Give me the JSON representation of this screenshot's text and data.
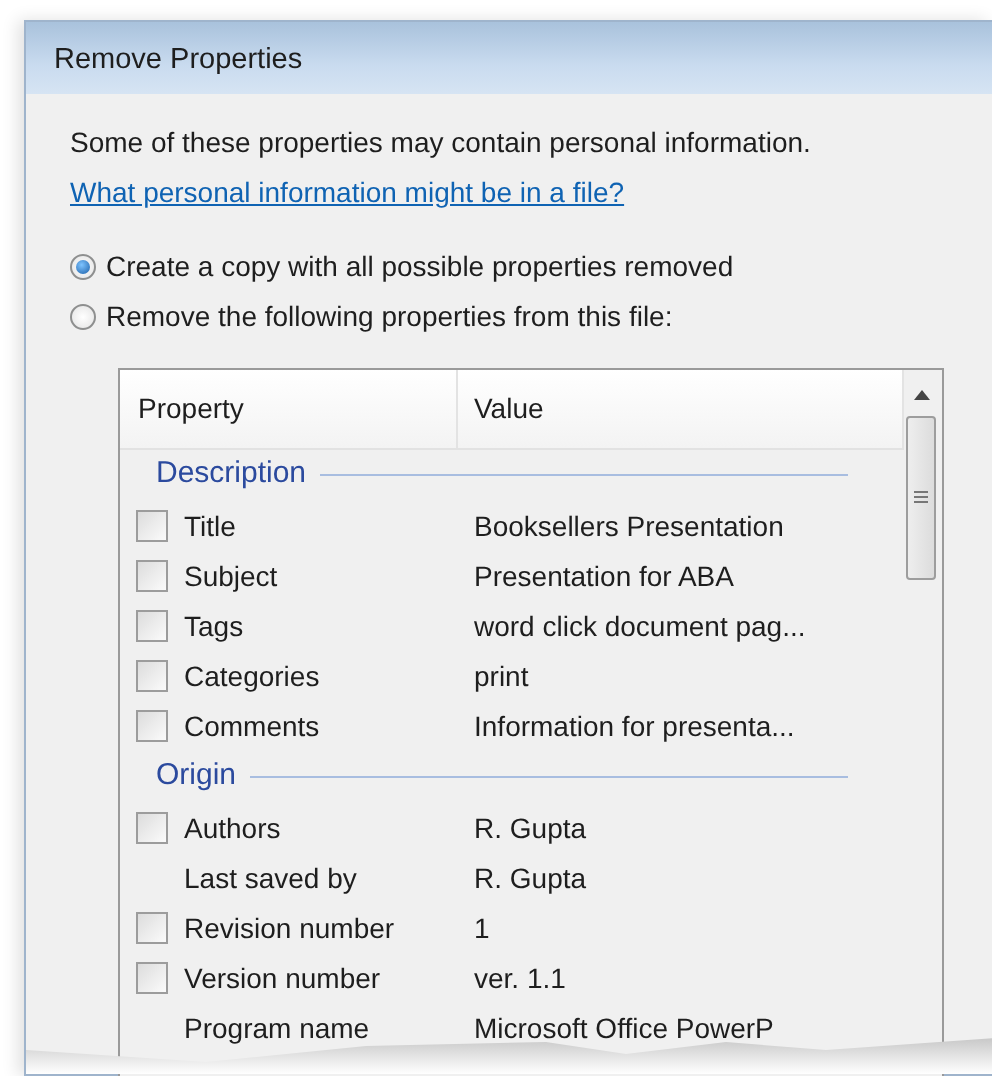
{
  "window": {
    "title": "Remove Properties"
  },
  "intro": "Some of these properties may contain personal information.",
  "help_link": "What personal information might be in a file?",
  "options": [
    {
      "label": "Create a copy with all possible properties removed",
      "selected": true
    },
    {
      "label": "Remove the following properties from this file:",
      "selected": false
    }
  ],
  "table": {
    "columns": [
      "Property",
      "Value"
    ],
    "groups": [
      {
        "name": "Description",
        "rows": [
          {
            "kind": "check",
            "checked": false,
            "property": "Title",
            "value": "Booksellers Presentation"
          },
          {
            "kind": "check",
            "checked": false,
            "property": "Subject",
            "value": "Presentation for ABA"
          },
          {
            "kind": "check",
            "checked": false,
            "property": "Tags",
            "value": "word click document pag..."
          },
          {
            "kind": "check",
            "checked": false,
            "property": "Categories",
            "value": "print"
          },
          {
            "kind": "check",
            "checked": false,
            "property": "Comments",
            "value": "Information for presenta..."
          }
        ]
      },
      {
        "name": "Origin",
        "rows": [
          {
            "kind": "check",
            "checked": false,
            "property": "Authors",
            "value": "R. Gupta"
          },
          {
            "kind": "plain",
            "property": "Last saved by",
            "value": "R. Gupta"
          },
          {
            "kind": "check",
            "checked": false,
            "property": "Revision number",
            "value": "1"
          },
          {
            "kind": "check",
            "checked": false,
            "property": "Version number",
            "value": "ver. 1.1"
          },
          {
            "kind": "plain",
            "property": "Program name",
            "value": "Microsoft Office PowerP"
          }
        ]
      }
    ]
  }
}
